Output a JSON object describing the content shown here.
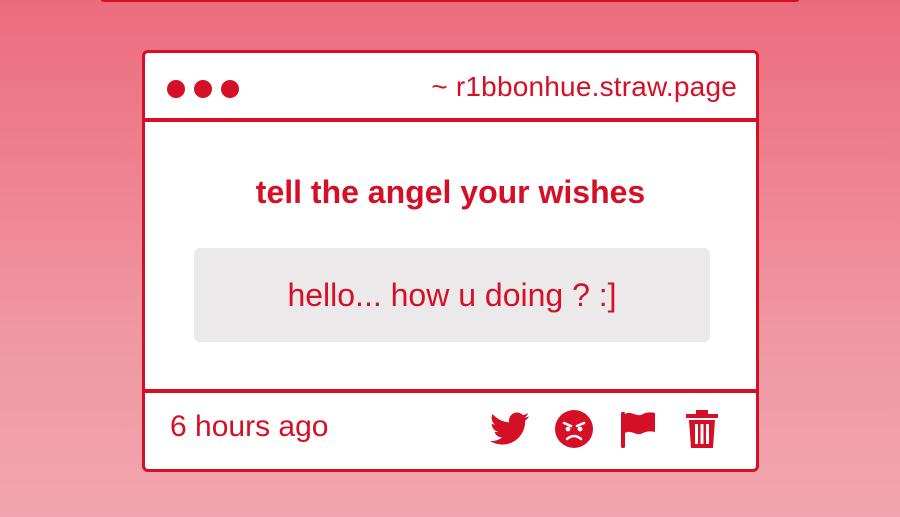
{
  "window": {
    "url": "~ r1bbonhue.straw.page"
  },
  "post": {
    "question": "tell the angel your wishes",
    "answer": "hello... how u doing ? :]",
    "timestamp": "6 hours ago"
  },
  "actions": [
    {
      "icon": "twitter-icon"
    },
    {
      "icon": "angry-face-icon"
    },
    {
      "icon": "flag-icon"
    },
    {
      "icon": "trash-icon"
    }
  ],
  "colors": {
    "accent": "#d50f25",
    "background_top": "#ec6c7d",
    "background_bottom": "#f2a5ae",
    "answer_bg": "#ece9ea",
    "card_bg": "#ffffff"
  }
}
